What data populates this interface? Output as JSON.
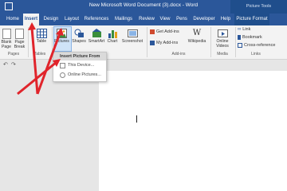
{
  "window": {
    "title": "New Microsoft Word Document (3).docx  -  Word",
    "tools_label": "Picture Tools"
  },
  "tabs": [
    "Home",
    "Insert",
    "Design",
    "Layout",
    "References",
    "Mailings",
    "Review",
    "View",
    "Pens",
    "Developer",
    "Help",
    "Picture Format"
  ],
  "ribbon": {
    "pages": {
      "blank_page": "Blank Page",
      "page_break": "Page Break",
      "group": "Pages"
    },
    "tables": {
      "table": "Table",
      "group": "Tables"
    },
    "illustrations": {
      "pictures": "Pictures",
      "shapes": "Shapes",
      "smartart": "SmartArt",
      "chart": "Chart",
      "screenshot": "Screenshot"
    },
    "addins": {
      "get": "Get Add-ins",
      "my": "My Add-ins",
      "wikipedia": "Wikipedia",
      "group": "Add-ins"
    },
    "media": {
      "online_videos": "Online Videos",
      "group": "Media"
    },
    "links": {
      "link": "Link",
      "bookmark": "Bookmark",
      "cross_reference": "Cross-reference",
      "group": "Links"
    }
  },
  "menu": {
    "header": "Insert Picture From",
    "items": [
      "This Device...",
      "Online Pictures..."
    ]
  },
  "colors": {
    "accent": "#2b579a",
    "arrow": "#e0242b"
  }
}
